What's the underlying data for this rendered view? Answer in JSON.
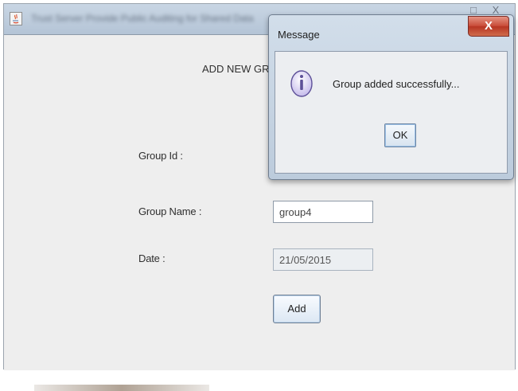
{
  "window": {
    "title": "Trust Server Provide Public Auditing for Shared Data",
    "maximize_glyph": "□",
    "close_glyph": "X"
  },
  "form": {
    "heading": "ADD NEW GRO",
    "group_id_label": "Group Id :",
    "group_name_label": "Group Name :",
    "group_name_value": "group4",
    "date_label": "Date :",
    "date_value": "21/05/2015",
    "add_label": "Add"
  },
  "dialog": {
    "title": "Message",
    "close_label": "X",
    "message": "Group added successfully...",
    "ok_label": "OK",
    "icon": "info-icon"
  },
  "colors": {
    "title_bar": "#c9d6e4",
    "dialog_close": "#c94d39",
    "info_icon": "#cfc6ef"
  }
}
